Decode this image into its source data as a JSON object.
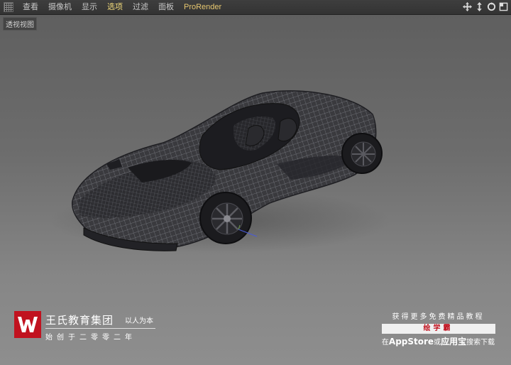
{
  "menu": {
    "items": [
      "查看",
      "摄像机",
      "显示",
      "选项",
      "过滤",
      "面板",
      "ProRender"
    ],
    "active_index": 3,
    "nav_icons": [
      "move-view-icon",
      "zoom-view-icon",
      "rotate-view-icon",
      "maximize-view-icon"
    ]
  },
  "viewport": {
    "label": "透视视图"
  },
  "brand": {
    "name": "王氏教育集团",
    "slogan": "以人为本",
    "founded": "始创于二零零二年"
  },
  "promo": {
    "top": "获得更多免费精品教程",
    "app": "绘学霸",
    "bottom_prefix": "在",
    "bottom_store": "AppStore",
    "bottom_or": "或",
    "bottom_yyb": "应用宝",
    "bottom_suffix": "搜索下载"
  },
  "colors": {
    "accent_active": "#f0d97a",
    "brand_red": "#c1121f"
  }
}
